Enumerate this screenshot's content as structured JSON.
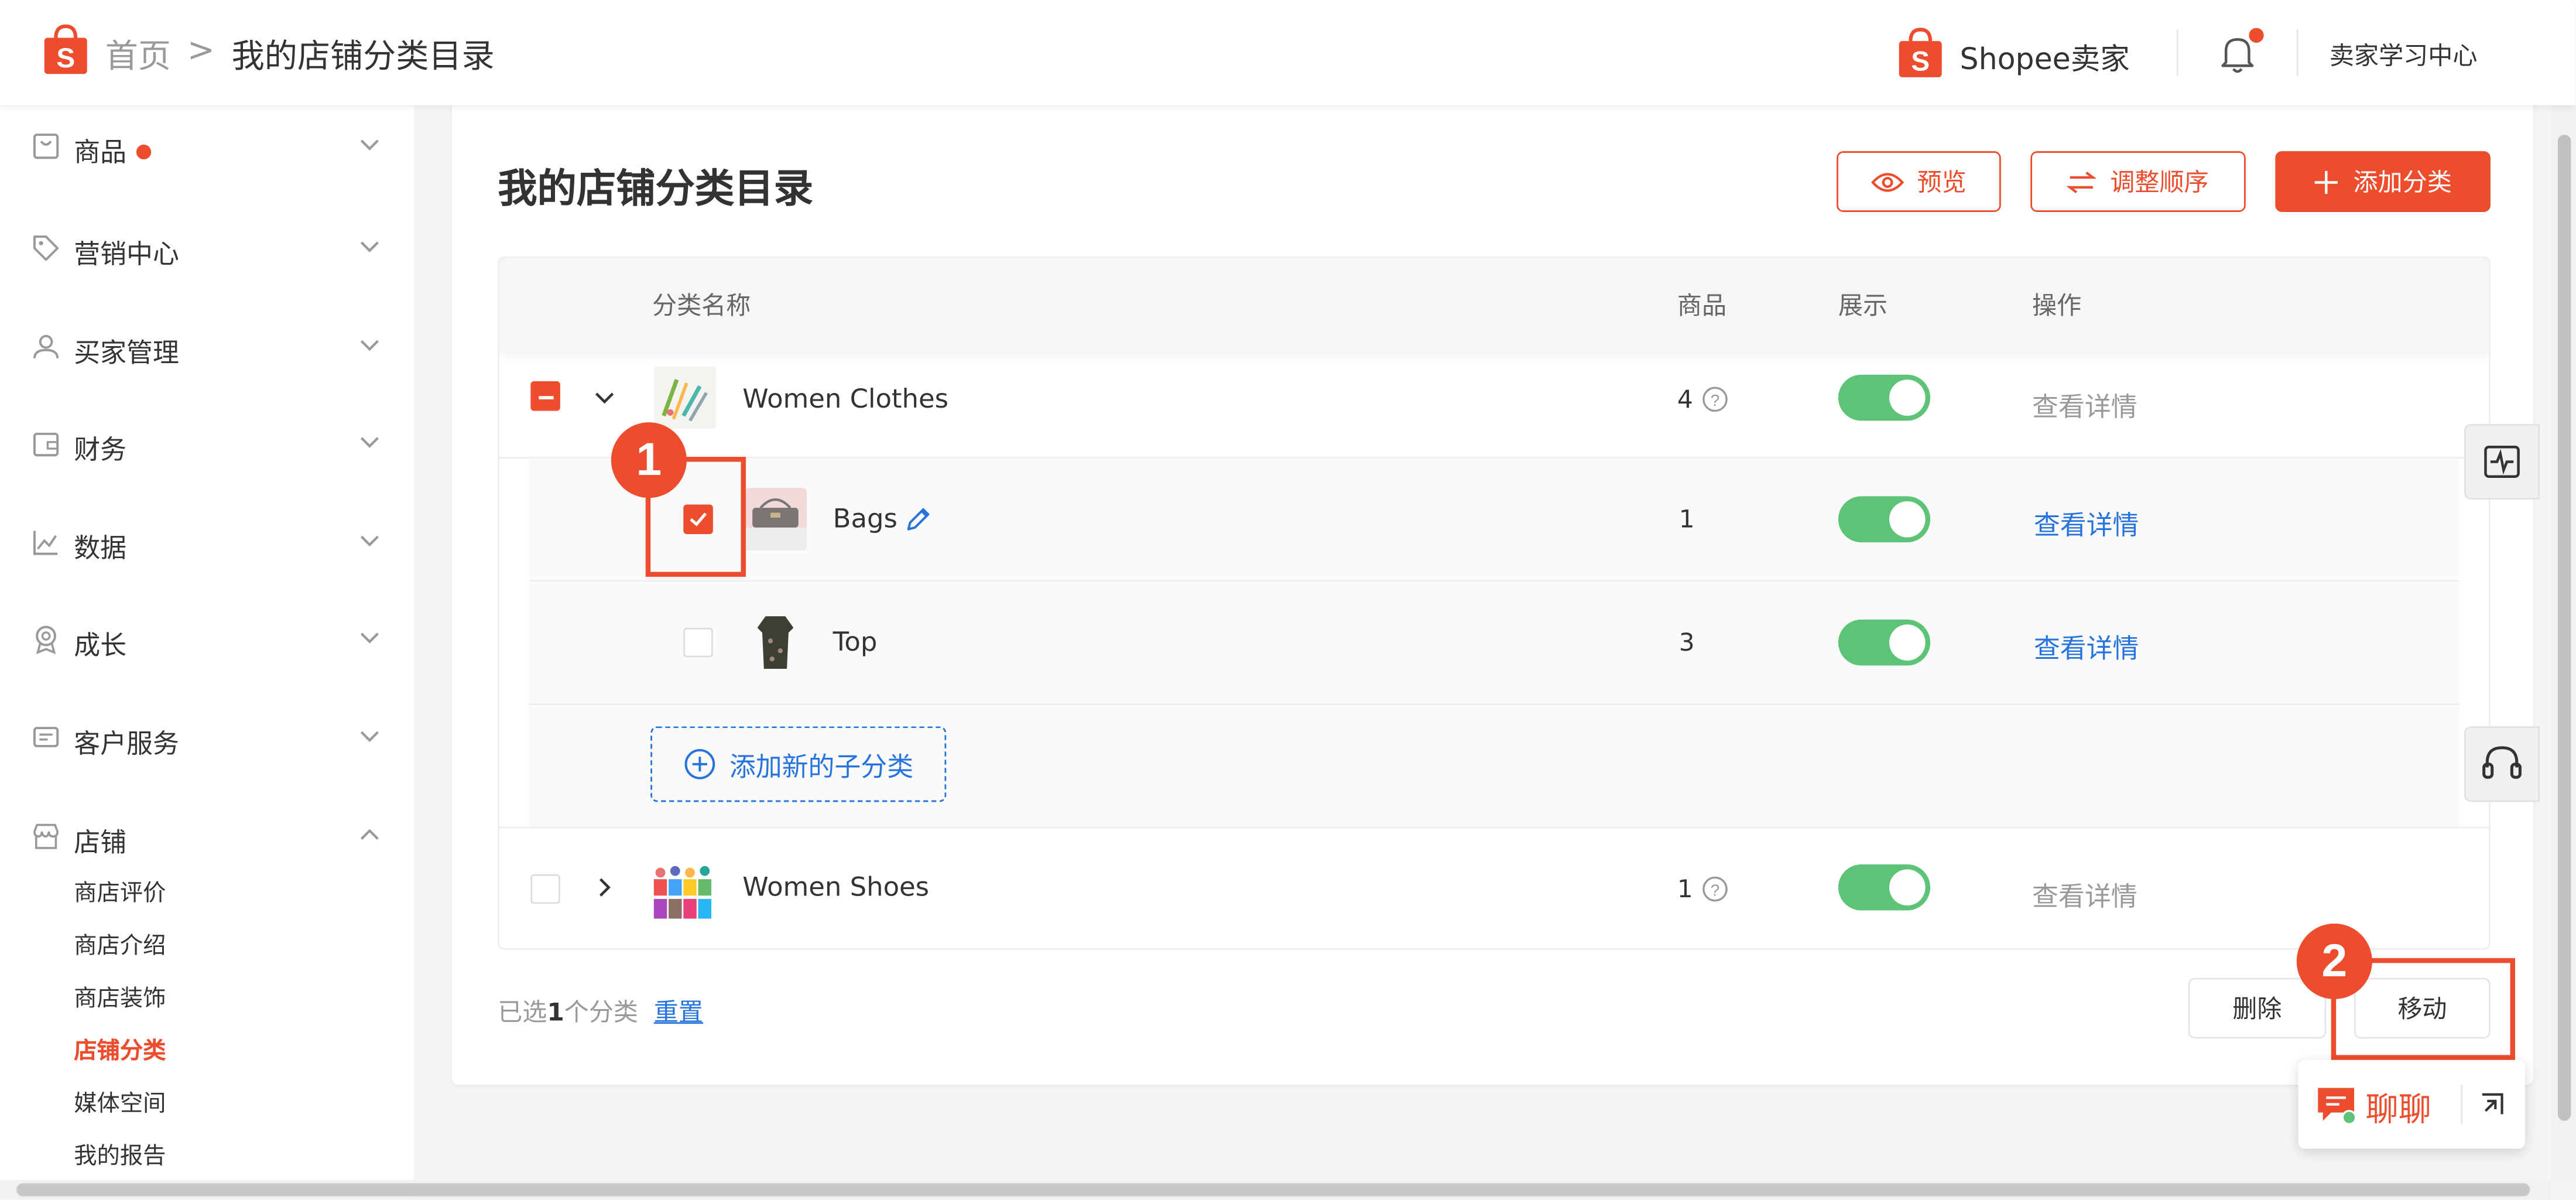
{
  "header": {
    "breadcrumb_home": "首页",
    "breadcrumb_sep": ">",
    "breadcrumb_current": "我的店铺分类目录",
    "brand": "Shopee卖家",
    "learning_center": "卖家学习中心"
  },
  "sidebar": {
    "items": [
      {
        "label": "商品",
        "icon": "product-icon",
        "badge": true
      },
      {
        "label": "营销中心",
        "icon": "tag-icon"
      },
      {
        "label": "买家管理",
        "icon": "user-icon"
      },
      {
        "label": "财务",
        "icon": "wallet-icon"
      },
      {
        "label": "数据",
        "icon": "chart-icon"
      },
      {
        "label": "成长",
        "icon": "medal-icon"
      },
      {
        "label": "客户服务",
        "icon": "service-icon"
      },
      {
        "label": "店铺",
        "icon": "store-icon",
        "expanded": true
      }
    ],
    "shop_sub": [
      {
        "label": "商店评价"
      },
      {
        "label": "商店介绍"
      },
      {
        "label": "商店装饰"
      },
      {
        "label": "店铺分类",
        "active": true
      },
      {
        "label": "媒体空间"
      },
      {
        "label": "我的报告"
      }
    ]
  },
  "page": {
    "title": "我的店铺分类目录",
    "btn_preview": "预览",
    "btn_reorder": "调整顺序",
    "btn_add": "添加分类"
  },
  "table": {
    "columns": {
      "name": "分类名称",
      "products": "商品",
      "display": "展示",
      "action": "操作"
    },
    "rows": [
      {
        "name": "Women Clothes",
        "count": "4",
        "display": true,
        "action": "查看详情",
        "level": 0,
        "expanded": true,
        "checkbox": "indeterminate"
      },
      {
        "name": "Bags",
        "count": "1",
        "display": true,
        "action": "查看详情",
        "level": 1,
        "checkbox": "checked"
      },
      {
        "name": "Top",
        "count": "3",
        "display": true,
        "action": "查看详情",
        "level": 1,
        "checkbox": "unchecked"
      },
      {
        "name": "Women Shoes",
        "count": "1",
        "display": true,
        "action": "查看详情",
        "level": 0,
        "expanded": false,
        "checkbox": "unchecked"
      }
    ],
    "add_sub": "添加新的子分类"
  },
  "footer": {
    "selected_prefix": "已选",
    "selected_count": "1",
    "selected_suffix": "个分类",
    "reset": "重置",
    "btn_delete": "删除",
    "btn_move": "移动"
  },
  "annotations": {
    "step1": "1",
    "step2": "2"
  },
  "chat": {
    "label": "聊聊"
  },
  "colors": {
    "accent": "#ee4d2d",
    "link": "#2673dd",
    "toggle_on": "#5dc377"
  }
}
